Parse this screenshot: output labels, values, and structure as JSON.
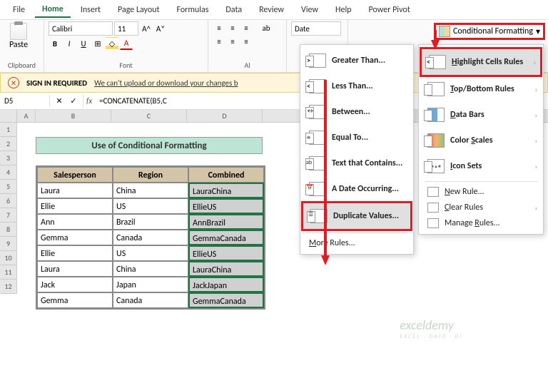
{
  "tabs": [
    "File",
    "Home",
    "Insert",
    "Page Layout",
    "Formulas",
    "Data",
    "Review",
    "View",
    "Help",
    "Power Pivot"
  ],
  "active_tab": "Home",
  "ribbon": {
    "paste_label": "Paste",
    "font_name": "Calibri",
    "font_size": "11",
    "bold": "B",
    "italic": "I",
    "underline": "U",
    "group_clipboard": "Clipboard",
    "group_font": "Font",
    "group_align": "Al",
    "number_format": "Date",
    "conditional_formatting": "Conditional Formatting"
  },
  "warning": {
    "title": "SIGN IN REQUIRED",
    "msg": "We can't upload or download your changes b"
  },
  "namebox": "D5",
  "formula": "=CONCATENATE(B5,C",
  "sheet_title": "Use of Conditional Formatting",
  "columns": [
    "A",
    "B",
    "C",
    "D"
  ],
  "rows": [
    "1",
    "2",
    "3",
    "4",
    "5",
    "6",
    "7",
    "8",
    "9",
    "10",
    "11",
    "12"
  ],
  "table": {
    "headers": [
      "Salesperson",
      "Region",
      "Combined"
    ],
    "data": [
      [
        "Laura",
        "China",
        "LauraChina"
      ],
      [
        "Ellie",
        "US",
        "EllieUS"
      ],
      [
        "Ann",
        "Brazil",
        "AnnBrazil"
      ],
      [
        "Gemma",
        "Canada",
        "GemmaCanada"
      ],
      [
        "Ellie",
        "US",
        "EllieUS"
      ],
      [
        "Laura",
        "China",
        "LauraChina"
      ],
      [
        "Jack",
        "Japan",
        "JackJapan"
      ],
      [
        "Gemma",
        "Canada",
        "GemmaCanada"
      ]
    ]
  },
  "menu1": {
    "items": [
      "Greater Than...",
      "Less Than...",
      "Between...",
      "Equal To...",
      "Text that Contains...",
      "A Date Occurring...",
      "Duplicate Values..."
    ],
    "more": "More Rules..."
  },
  "menu2": {
    "items": [
      "Highlight Cells Rules",
      "Top/Bottom Rules",
      "Data Bars",
      "Color Scales",
      "Icon Sets"
    ],
    "new_rule": "New Rule...",
    "clear": "Clear Rules",
    "manage": "Manage Rules..."
  },
  "watermark": "exceldemy",
  "watermark_sub": "EXCEL · DATA · BI"
}
